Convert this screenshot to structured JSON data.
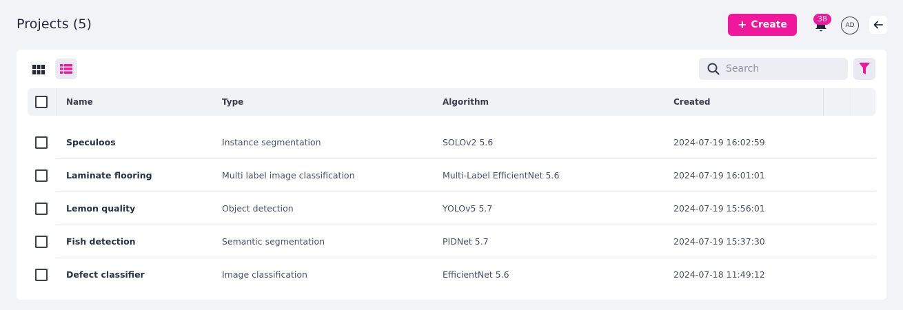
{
  "header": {
    "title": "Projects (5)",
    "create_label": "Create",
    "notification_count": "38",
    "avatar_initials": "AD"
  },
  "toolbar": {
    "search_placeholder": "Search",
    "accent_color": "#f0179b"
  },
  "table": {
    "columns": [
      "Name",
      "Type",
      "Algorithm",
      "Created"
    ],
    "rows": [
      {
        "name": "Speculoos",
        "type": "Instance segmentation",
        "algorithm": "SOLOv2 5.6",
        "created": "2024-07-19 16:02:59"
      },
      {
        "name": "Laminate flooring",
        "type": "Multi label image classification",
        "algorithm": "Multi-Label EfficientNet 5.6",
        "created": "2024-07-19 16:01:01"
      },
      {
        "name": "Lemon quality",
        "type": "Object detection",
        "algorithm": "YOLOv5 5.7",
        "created": "2024-07-19 15:56:01"
      },
      {
        "name": "Fish detection",
        "type": "Semantic segmentation",
        "algorithm": "PIDNet 5.7",
        "created": "2024-07-19 15:37:30"
      },
      {
        "name": "Defect classifier",
        "type": "Image classification",
        "algorithm": "EfficientNet 5.6",
        "created": "2024-07-18 11:49:12"
      }
    ]
  }
}
